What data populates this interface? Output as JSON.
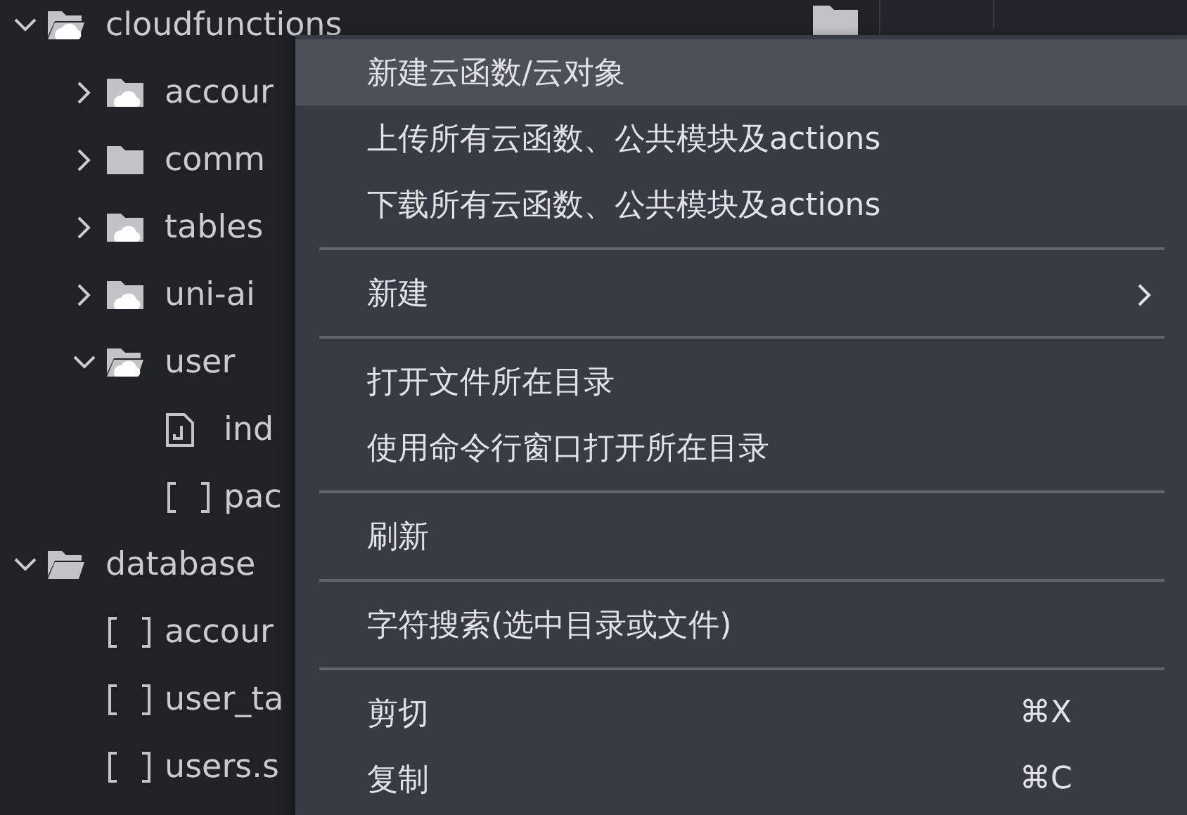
{
  "tree": [
    {
      "name": "cloudfunctions",
      "kind": "cloud-folder",
      "expanded": true,
      "children": [
        {
          "name": "accour",
          "kind": "cloud-folder",
          "expanded": false
        },
        {
          "name": "comm",
          "kind": "folder",
          "expanded": false
        },
        {
          "name": "tables",
          "kind": "cloud-folder",
          "expanded": false
        },
        {
          "name": "uni-ai",
          "kind": "cloud-folder",
          "expanded": false
        },
        {
          "name": "user",
          "kind": "cloud-folder",
          "expanded": true,
          "children": [
            {
              "name": "ind",
              "kind": "js"
            },
            {
              "name": "pac",
              "kind": "json"
            }
          ]
        }
      ]
    },
    {
      "name": "database",
      "kind": "folder",
      "expanded": true,
      "children": [
        {
          "name": "accour",
          "kind": "json"
        },
        {
          "name": "user_ta",
          "kind": "json"
        },
        {
          "name": "users.s",
          "kind": "json"
        }
      ]
    }
  ],
  "context_menu": [
    {
      "kind": "item",
      "label": "新建云函数/云对象",
      "selected": true
    },
    {
      "kind": "item",
      "label": "上传所有云函数、公共模块及actions",
      "selected": false
    },
    {
      "kind": "item",
      "label": "下载所有云函数、公共模块及actions",
      "selected": false
    },
    {
      "kind": "separator"
    },
    {
      "kind": "item",
      "label": "新建",
      "selected": false,
      "submenu": true
    },
    {
      "kind": "separator"
    },
    {
      "kind": "item",
      "label": "打开文件所在目录",
      "selected": false
    },
    {
      "kind": "item",
      "label": "使用命令行窗口打开所在目录",
      "selected": false
    },
    {
      "kind": "separator"
    },
    {
      "kind": "item",
      "label": "刷新",
      "selected": false
    },
    {
      "kind": "separator"
    },
    {
      "kind": "item",
      "label": "字符搜索(选中目录或文件)",
      "selected": false
    },
    {
      "kind": "separator"
    },
    {
      "kind": "item",
      "label": "剪切",
      "selected": false,
      "shortcut": "⌘X"
    },
    {
      "kind": "item",
      "label": "复制",
      "selected": false,
      "shortcut": "⌘C"
    }
  ]
}
